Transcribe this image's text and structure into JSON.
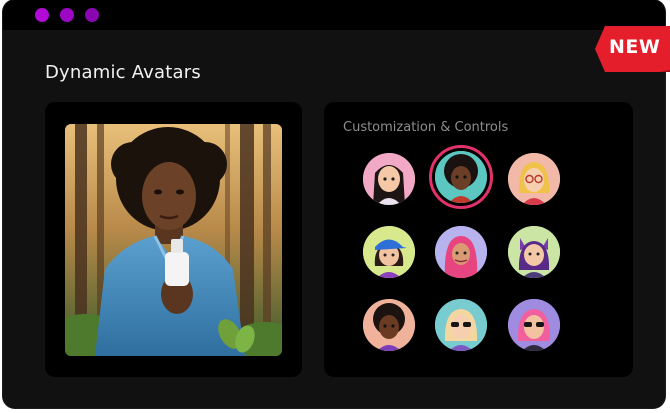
{
  "window": {
    "dots": [
      "#b10ad6",
      "#9d08c4",
      "#8a06b0"
    ]
  },
  "badge": {
    "label": "NEW",
    "color": "#e41e2b"
  },
  "app": {
    "title": "Dynamic Avatars"
  },
  "photo": {
    "icon": "portrait-photo"
  },
  "controls": {
    "label": "Customization & Controls",
    "selected_index": 1,
    "selection_color": "#e2326c",
    "avatars": [
      {
        "name": "avatar-long-black-hair",
        "bg": "#f2a9c6"
      },
      {
        "name": "avatar-afro",
        "bg": "#5cc6c0"
      },
      {
        "name": "avatar-blonde-glasses",
        "bg": "#f2b8a8"
      },
      {
        "name": "avatar-blue-cap",
        "bg": "#d7e88d"
      },
      {
        "name": "avatar-pink-hijab",
        "bg": "#b7b3ee"
      },
      {
        "name": "avatar-cat-ears",
        "bg": "#cbe6a4"
      },
      {
        "name": "avatar-curly-hair",
        "bg": "#f0b29a"
      },
      {
        "name": "avatar-sunglasses-blonde",
        "bg": "#78ccd0"
      },
      {
        "name": "avatar-pink-hair-sunglasses",
        "bg": "#9f8be0"
      }
    ]
  }
}
